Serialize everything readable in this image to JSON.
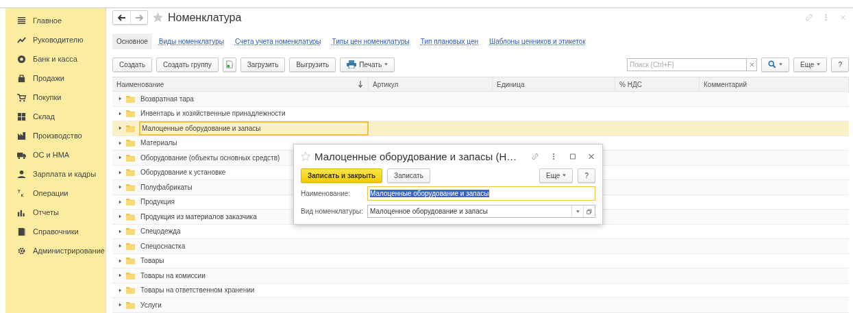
{
  "sidebar": {
    "items": [
      {
        "label": "Главное"
      },
      {
        "label": "Руководителю"
      },
      {
        "label": "Банк и касса"
      },
      {
        "label": "Продажи"
      },
      {
        "label": "Покупки"
      },
      {
        "label": "Склад"
      },
      {
        "label": "Производство"
      },
      {
        "label": "ОС и НМА"
      },
      {
        "label": "Зарплата и кадры"
      },
      {
        "label": "Операции"
      },
      {
        "label": "Отчеты"
      },
      {
        "label": "Справочники"
      },
      {
        "label": "Администрирование"
      }
    ]
  },
  "window": {
    "title": "Номенклатура"
  },
  "tabs": [
    {
      "label": "Основное",
      "selected": true
    },
    {
      "label": "Виды номенклатуры",
      "selected": false
    },
    {
      "label": "Счета учета номенклатуры",
      "selected": false
    },
    {
      "label": "Типы цен номенклатуры",
      "selected": false
    },
    {
      "label": "Тип плановых цен",
      "selected": false
    },
    {
      "label": "Шаблоны ценников и этикеток",
      "selected": false
    }
  ],
  "toolbar": {
    "buttons": [
      {
        "kind": "text",
        "label": "Создать"
      },
      {
        "kind": "text",
        "label": "Создать группу"
      },
      {
        "kind": "copy"
      },
      {
        "kind": "text",
        "label": "Загрузить"
      },
      {
        "kind": "text",
        "label": "Выгрузить"
      },
      {
        "kind": "print",
        "label": "Печать"
      }
    ],
    "search": {
      "placeholder": "Поиск (Ctrl+F)"
    },
    "more": "Еще",
    "help": "?"
  },
  "table": {
    "columns": [
      {
        "label": "Наименование",
        "sorted": true
      },
      {
        "label": "Артикул",
        "sorted": false
      },
      {
        "label": "Единица",
        "sorted": false
      },
      {
        "label": "% НДС",
        "sorted": false
      },
      {
        "label": "Комментарий",
        "sorted": false
      }
    ],
    "rows": [
      {
        "name": "Возвратная тара",
        "selected": false
      },
      {
        "name": "Инвентарь и хозяйственные принадлежности",
        "selected": false
      },
      {
        "name": "Малоценные оборудование и запасы",
        "selected": true
      },
      {
        "name": "Материалы",
        "selected": false
      },
      {
        "name": "Оборудование (объекты основных средств)",
        "selected": false
      },
      {
        "name": "Оборудование к установке",
        "selected": false
      },
      {
        "name": "Полуфабрикаты",
        "selected": false
      },
      {
        "name": "Продукция",
        "selected": false
      },
      {
        "name": "Продукция из материалов заказчика",
        "selected": false
      },
      {
        "name": "Спецодежда",
        "selected": false
      },
      {
        "name": "Спецоснастка",
        "selected": false
      },
      {
        "name": "Товары",
        "selected": false
      },
      {
        "name": "Товары на комиссии",
        "selected": false
      },
      {
        "name": "Товары на ответственном хранении",
        "selected": false
      },
      {
        "name": "Услуги",
        "selected": false
      }
    ]
  },
  "dialog": {
    "title": "Малоценные оборудование и запасы (Н…",
    "save_close": "Записать и закрыть",
    "save": "Записать",
    "more": "Еще",
    "help": "?",
    "fields": [
      {
        "kind": "text",
        "label": "Наименование:",
        "value": "Малоценные оборудование и запасы",
        "value_selected": true
      },
      {
        "kind": "select",
        "label": "Вид номенклатуры:",
        "value": "Малоценное оборудование и запасы",
        "value_selected": false
      }
    ]
  }
}
